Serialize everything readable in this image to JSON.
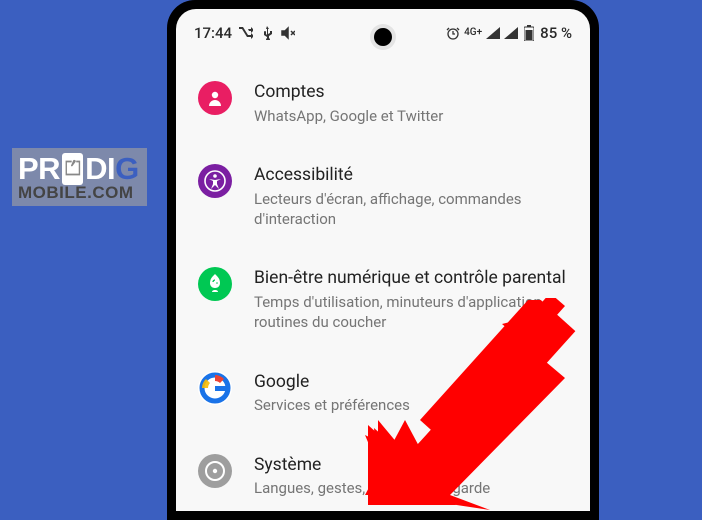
{
  "status_bar": {
    "time": "17:44",
    "battery": "85 %",
    "network": "4G+",
    "left_icons": [
      "shuffle",
      "usb",
      "volume-off"
    ],
    "right_icons": [
      "alarm",
      "signal-4g",
      "signal",
      "signal",
      "battery"
    ]
  },
  "settings": [
    {
      "key": "accounts",
      "title": "Comptes",
      "subtitle": "WhatsApp, Google et Twitter",
      "icon_color": "#e91e63"
    },
    {
      "key": "accessibility",
      "title": "Accessibilité",
      "subtitle": "Lecteurs d'écran, affichage, commandes d'interaction",
      "icon_color": "#7b1fa2"
    },
    {
      "key": "wellbeing",
      "title": "Bien-être numérique et contrôle parental",
      "subtitle": "Temps d'utilisation, minuteurs d'application, routines du coucher",
      "icon_color": "#00c853"
    },
    {
      "key": "google",
      "title": "Google",
      "subtitle": "Services et préférences",
      "icon_color": "#ffffff"
    },
    {
      "key": "system",
      "title": "Système",
      "subtitle": "Langues, gestes, heure, sauvegarde",
      "icon_color": "#9e9e9e"
    }
  ],
  "watermark": {
    "top": "PRODIG",
    "bottom": "MOBILE.COM"
  },
  "annotations": {
    "arrow_target": "system",
    "arrow_color": "#ff0000"
  }
}
